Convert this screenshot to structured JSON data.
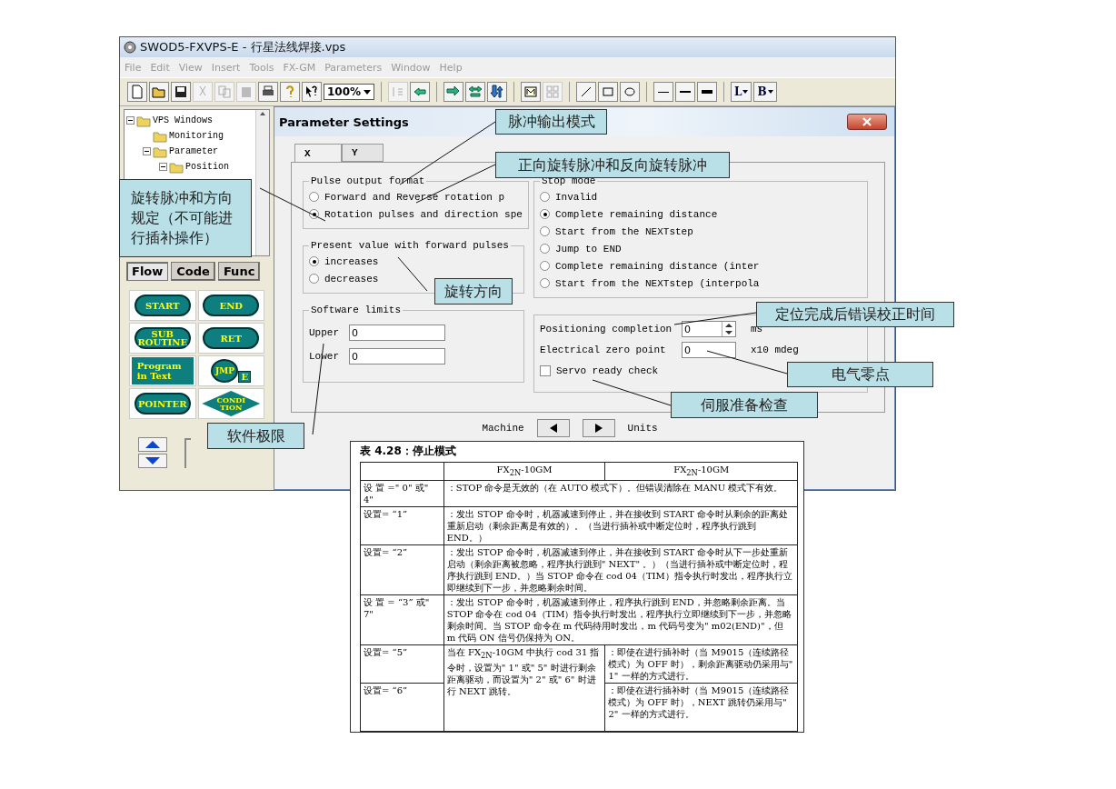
{
  "window": {
    "title": "SWOD5-FXVPS-E - 行星法线焊接.vps"
  },
  "menu": [
    "File",
    "Edit",
    "View",
    "Insert",
    "Tools",
    "FX-GM",
    "Parameters",
    "Window",
    "Help"
  ],
  "toolbar": {
    "zoom": "100%",
    "line_button": "L",
    "fill_button": "B"
  },
  "tree": [
    {
      "label": "VPS Windows",
      "expanded": true,
      "children": [
        {
          "label": "Monitoring"
        },
        {
          "label": "Parameter",
          "expanded": true,
          "children": [
            {
              "label": "Position",
              "expanded": true
            }
          ]
        }
      ]
    }
  ],
  "palette_tabs": [
    {
      "label": "Flow",
      "selected": true
    },
    {
      "label": "Code",
      "selected": false
    },
    {
      "label": "Func",
      "selected": false
    }
  ],
  "palette": [
    {
      "kind": "pill",
      "label": "START"
    },
    {
      "kind": "pill",
      "label": "END"
    },
    {
      "kind": "pill",
      "label": "SUB\nROUTINE"
    },
    {
      "kind": "pill",
      "label": "RET"
    },
    {
      "kind": "block",
      "label": "Program\nin Text"
    },
    {
      "kind": "jmp",
      "label": "JMP",
      "badge": "E"
    },
    {
      "kind": "pill",
      "label": "POINTER"
    },
    {
      "kind": "diamond",
      "label": "CONDI\nTION"
    }
  ],
  "dialog": {
    "title": "Parameter Settings",
    "tabs": [
      {
        "label": "X",
        "selected": true
      },
      {
        "label": "Y",
        "selected": false
      }
    ],
    "pulse_output_format": {
      "title": "Pulse output format",
      "options": [
        {
          "label": "Forward and Reverse rotation p",
          "selected": false
        },
        {
          "label": "Rotation pulses and direction spe",
          "selected": true
        }
      ]
    },
    "present_value": {
      "title": "Present value with forward pulses",
      "options": [
        {
          "label": "increases",
          "selected": true
        },
        {
          "label": "decreases",
          "selected": false
        }
      ]
    },
    "software_limits": {
      "title": "Software limits",
      "fields": [
        {
          "label": "Upper",
          "value": "0"
        },
        {
          "label": "Lower",
          "value": "0"
        }
      ]
    },
    "stop_mode": {
      "title": "Stop mode",
      "options": [
        {
          "label": "Invalid",
          "selected": false
        },
        {
          "label": "Complete remaining distance",
          "selected": true
        },
        {
          "label": "Start from the NEXTstep",
          "selected": false
        },
        {
          "label": "Jump to END",
          "selected": false
        },
        {
          "label": "Complete remaining distance (inter",
          "selected": false
        },
        {
          "label": "Start from the NEXTstep (interpola",
          "selected": false
        }
      ]
    },
    "positioning_completion": {
      "label": "Positioning completion",
      "value": "0",
      "unit": "ms"
    },
    "electrical_zero_point": {
      "label": "Electrical zero point",
      "value": "0",
      "unit": "x10 mdeg"
    },
    "servo_ready_check": {
      "label": "Servo ready check",
      "checked": false
    },
    "footer": {
      "left": "Machine",
      "right": "Units"
    }
  },
  "callouts": [
    {
      "text": "脉冲输出模式"
    },
    {
      "text": "正向旋转脉冲和反向旋转脉冲"
    },
    {
      "text": "旋转脉冲和方向规定（不可能进行插补操作）"
    },
    {
      "text": "旋转方向"
    },
    {
      "text": "定位完成后错误校正时间"
    },
    {
      "text": "电气零点"
    },
    {
      "text": "伺服准备检查"
    },
    {
      "text": "软件极限"
    }
  ],
  "table": {
    "title": "表 4.28：停止模式",
    "headers": [
      "FX$_{2N}$-10GM",
      "FX$_{2N}$-10GM"
    ],
    "rows": [
      {
        "setting": "设 置 =\" 0\" 或\" 4\"",
        "description": "：STOP 命令是无效的（在 AUTO 模式下）。但错误清除在 MANU 模式下有效。"
      },
      {
        "setting": "设置= “1”",
        "description": "：发出 STOP 命令时，机器减速到停止，并在接收到 START 命令时从剩余的距离处重新启动（剩余距离是有效的）。（当进行插补或中断定位时，程序执行跳到 END。）"
      },
      {
        "setting": "设置= “2”",
        "description": "：发出 STOP 命令时，机器减速到停止，并在接收到 START 命令时从下一步处重新启动（剩余距离被忽略，程序执行跳到\" NEXT\" 。）（当进行插补或中断定位时，程序执行跳到 END。）当 STOP 命令在 cod 04（TIM）指令执行时发出，程序执行立即继续到下一步，并忽略剩余时间。"
      },
      {
        "setting": "设 置 = “3” 或\" 7\"",
        "description": "：发出 STOP 命令时，机器减速到停止，程序执行跳到 END，并忽略剩余距离。当 STOP 命令在 cod 04（TIM）指令执行时发出，程序执行立即继续到下一步，并忽略剩余时间。当 STOP 命令在 m 代码待用时发出，m 代码号变为\" m02(END)\"，但 m 代码 ON 信号仍保持为 ON。"
      }
    ],
    "shared_note": "当在 FX$_{2N}$-10GM 中执行 cod 31 指令时，设置为\" 1\" 或\" 5\" 时进行剩余距离驱动，而设置为\" 2\" 或\" 6\" 时进行 NEXT 跳转。",
    "split_rows": [
      {
        "setting": "设置= “5”",
        "description": "：即使在进行插补时（当 M9015（连续路径模式）为 OFF 时），剩余距离驱动仍采用与\" 1\" 一样的方式进行。"
      },
      {
        "setting": "设置= “6”",
        "description": "：即使在进行插补时（当 M9015（连续路径模式）为 OFF 时），NEXT 跳转仍采用与\" 2\" 一样的方式进行。"
      }
    ]
  }
}
